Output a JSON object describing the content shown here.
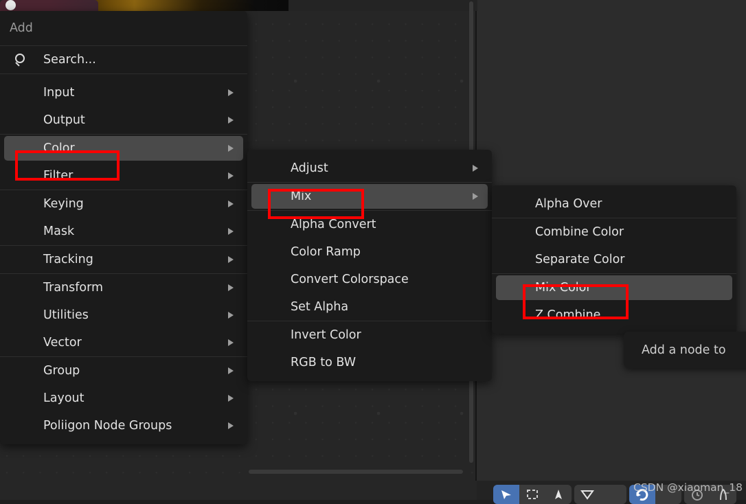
{
  "app": {
    "editor": "blender-compositor-node-editor",
    "background_color": "#262626",
    "panel_color": "#1b1b1b",
    "highlight_color": "#4a4a4a",
    "annotation_color": "#fe0000"
  },
  "add_menu": {
    "title": "Add",
    "search": {
      "placeholder": "Search...",
      "label": "Search...",
      "icon": "search-icon"
    },
    "groups": [
      {
        "items": [
          {
            "label": "Input",
            "submenu": true
          },
          {
            "label": "Output",
            "submenu": true
          }
        ]
      },
      {
        "items": [
          {
            "label": "Color",
            "submenu": true,
            "selected": true,
            "annotated": true
          },
          {
            "label": "Filter",
            "submenu": true
          }
        ]
      },
      {
        "items": [
          {
            "label": "Keying",
            "submenu": true
          },
          {
            "label": "Mask",
            "submenu": true
          }
        ]
      },
      {
        "items": [
          {
            "label": "Tracking",
            "submenu": true
          }
        ]
      },
      {
        "items": [
          {
            "label": "Transform",
            "submenu": true
          },
          {
            "label": "Utilities",
            "submenu": true
          },
          {
            "label": "Vector",
            "submenu": true
          }
        ]
      },
      {
        "items": [
          {
            "label": "Group",
            "submenu": true
          },
          {
            "label": "Layout",
            "submenu": true
          },
          {
            "label": "Poliigon Node Groups",
            "submenu": true
          }
        ]
      }
    ]
  },
  "color_submenu": {
    "groups": [
      {
        "items": [
          {
            "label": "Adjust",
            "submenu": true
          }
        ]
      },
      {
        "items": [
          {
            "label": "Mix",
            "submenu": true,
            "selected": true,
            "annotated": true
          }
        ]
      },
      {
        "items": [
          {
            "label": "Alpha Convert",
            "submenu": false
          },
          {
            "label": "Color Ramp",
            "submenu": false
          },
          {
            "label": "Convert Colorspace",
            "submenu": false
          },
          {
            "label": "Set Alpha",
            "submenu": false
          }
        ]
      },
      {
        "items": [
          {
            "label": "Invert Color",
            "submenu": false
          },
          {
            "label": "RGB to BW",
            "submenu": false
          }
        ]
      }
    ]
  },
  "mix_submenu": {
    "groups": [
      {
        "items": [
          {
            "label": "Alpha Over",
            "submenu": false
          }
        ]
      },
      {
        "items": [
          {
            "label": "Combine Color",
            "submenu": false
          },
          {
            "label": "Separate Color",
            "submenu": false
          }
        ]
      },
      {
        "items": [
          {
            "label": "Mix Color",
            "submenu": false,
            "selected": true,
            "annotated": true
          },
          {
            "label": "Z Combine",
            "submenu": false
          }
        ]
      }
    ]
  },
  "tooltip": {
    "text": "Add a node to"
  },
  "toolbar": {
    "buttons": [
      {
        "name": "select-tool",
        "icon": "cursor-arrow-icon",
        "active": true
      },
      {
        "name": "select-box-tool",
        "icon": "dashed-box-icon",
        "active": false
      },
      {
        "name": "tweak-tool",
        "icon": "cursor-triangle-icon",
        "active": false
      },
      {
        "name": "links-cut-tool",
        "icon": "funnel-icon",
        "active": false
      },
      {
        "name": "rotate-tool",
        "icon": "rotate-icon",
        "active": true
      },
      {
        "name": "measure-tool",
        "icon": "clock-icon",
        "active": false
      },
      {
        "name": "annotate-tool",
        "icon": "pen-icon",
        "active": false
      }
    ]
  },
  "watermark": {
    "text": "CSDN @xiaoman_18"
  }
}
